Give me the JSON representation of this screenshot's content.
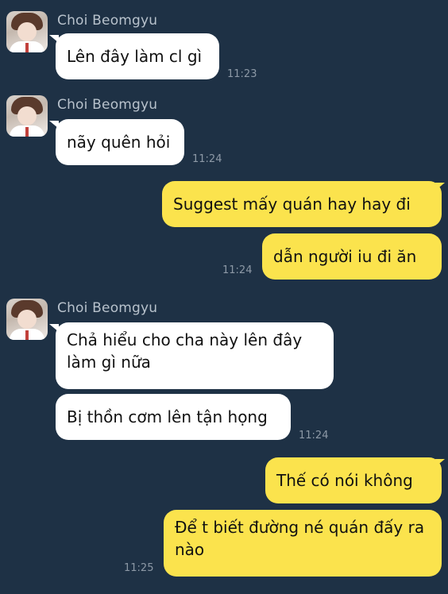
{
  "contact": {
    "name": "Choi Beomgyu"
  },
  "messages": [
    {
      "text": "Lên đây làm cl gì",
      "time": "11:23"
    },
    {
      "text": "nãy quên hỏi",
      "time": "11:24"
    },
    {
      "text": "Suggest mấy quán hay hay đi"
    },
    {
      "text": "dẫn người iu đi ăn",
      "time": "11:24"
    },
    {
      "text": "Chả hiểu cho cha này lên đây làm gì nữa"
    },
    {
      "text": "Bị thồn cơm lên tận họng",
      "time": "11:24"
    },
    {
      "text": "Thế có nói không"
    },
    {
      "text": "Để t biết đường né quán đấy ra nào",
      "time": "11:25"
    }
  ]
}
